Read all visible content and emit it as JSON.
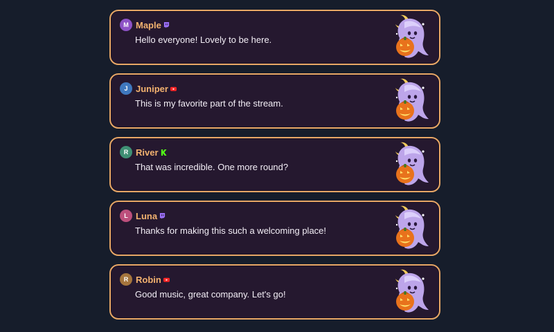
{
  "messages": [
    {
      "initial": "M",
      "username": "Maple",
      "platform": "twitch-icon",
      "avatar_color": "#8d52c6",
      "text": "Hello everyone! Lovely to be here."
    },
    {
      "initial": "J",
      "username": "Juniper",
      "platform": "youtube-icon",
      "avatar_color": "#3f78be",
      "text": "This is my favorite part of the stream."
    },
    {
      "initial": "R",
      "username": "River",
      "platform": "kick-icon",
      "avatar_color": "#3f8f74",
      "text": "That was incredible. One more round?"
    },
    {
      "initial": "L",
      "username": "Luna",
      "platform": "twitch-icon",
      "avatar_color": "#bd4f7c",
      "text": "Thanks for making this such a welcoming place!"
    },
    {
      "initial": "R",
      "username": "Robin",
      "platform": "youtube-icon",
      "avatar_color": "#a5753d",
      "text": "Good music, great company. Let's go!"
    }
  ],
  "colors": {
    "background": "#161d2b",
    "card": "#25182f",
    "border": "#e8a766",
    "username": "#f3b26f",
    "twitch": "#9e72ff",
    "youtube": "#ff2626",
    "kick": "#53fc18"
  },
  "decoration": "ghost-pumpkin-moon-icon"
}
